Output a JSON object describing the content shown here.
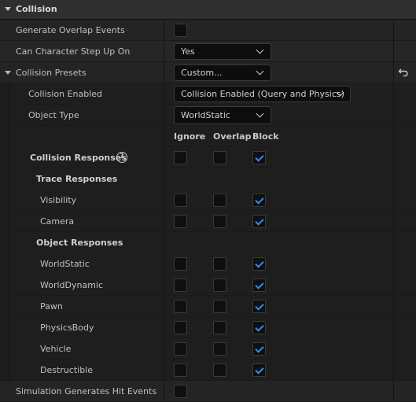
{
  "section": {
    "title": "Collision"
  },
  "rows": {
    "generate_overlap": {
      "label": "Generate Overlap Events",
      "checked": false
    },
    "step_up": {
      "label": "Can Character Step Up On",
      "value": "Yes"
    },
    "presets": {
      "label": "Collision Presets",
      "value": "Custom..."
    },
    "collision_enabled": {
      "label": "Collision Enabled",
      "value": "Collision Enabled (Query and Physics)"
    },
    "object_type": {
      "label": "Object Type",
      "value": "WorldStatic"
    },
    "columns": {
      "ignore": "Ignore",
      "overlap": "Overlap",
      "block": "Block"
    },
    "collision_responses": {
      "label": "Collision Responses",
      "help": "?"
    },
    "trace_responses": {
      "label": "Trace Responses"
    },
    "visibility": {
      "label": "Visibility"
    },
    "camera": {
      "label": "Camera"
    },
    "object_responses": {
      "label": "Object Responses"
    },
    "worldstatic": {
      "label": "WorldStatic"
    },
    "worlddynamic": {
      "label": "WorldDynamic"
    },
    "pawn": {
      "label": "Pawn"
    },
    "physicsbody": {
      "label": "PhysicsBody"
    },
    "vehicle": {
      "label": "Vehicle"
    },
    "destructible": {
      "label": "Destructible"
    },
    "sim_hit": {
      "label": "Simulation Generates Hit Events",
      "checked": false
    }
  },
  "colors": {
    "accent": "#2f8cff",
    "background": "#242424"
  },
  "icons": {
    "reset": "reset-arrow-icon",
    "help": "help-circle-icon"
  }
}
